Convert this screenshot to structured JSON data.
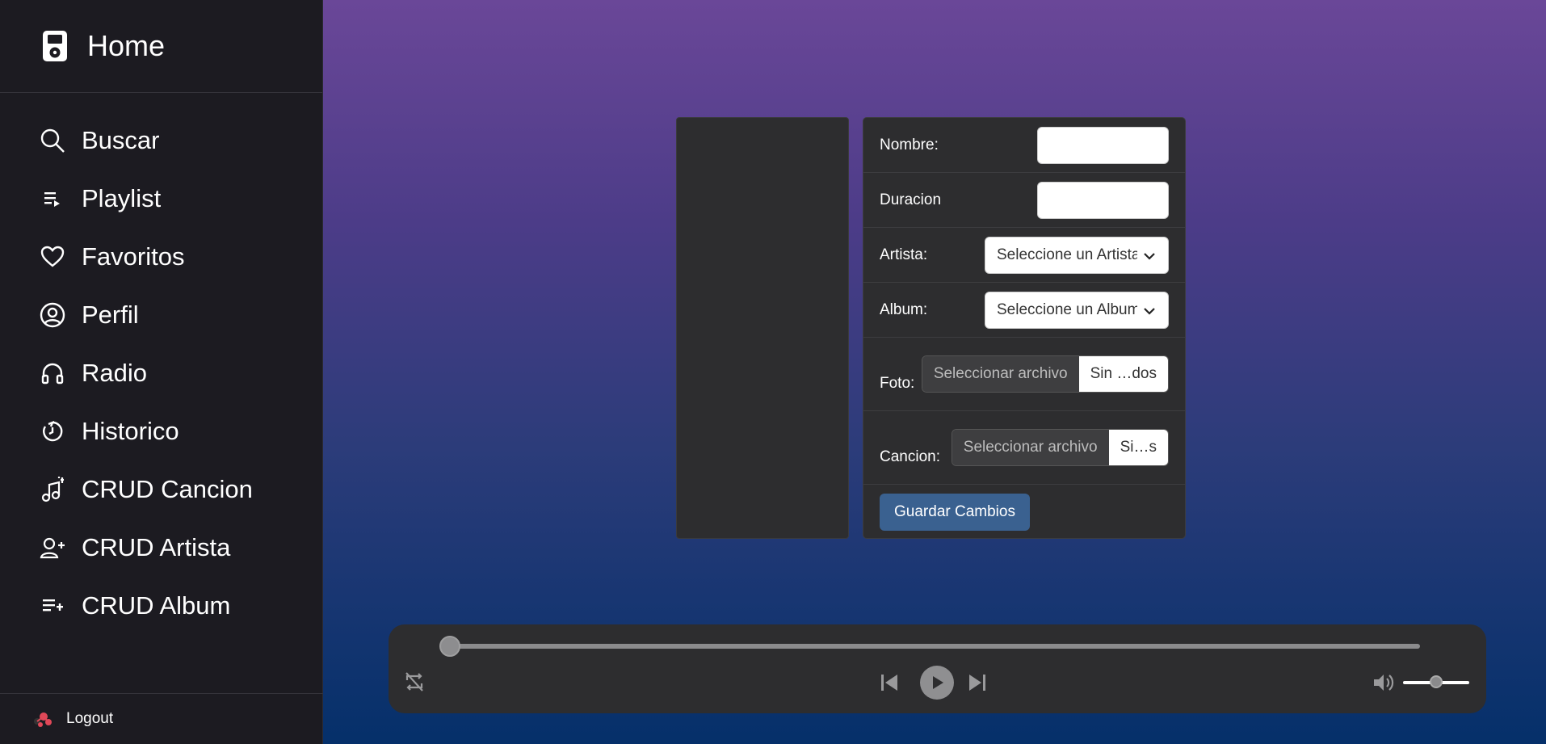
{
  "sidebar": {
    "home_label": "Home",
    "items": [
      {
        "label": "Buscar",
        "icon": "search-icon"
      },
      {
        "label": "Playlist",
        "icon": "playlist-icon"
      },
      {
        "label": "Favoritos",
        "icon": "heart-icon"
      },
      {
        "label": "Perfil",
        "icon": "user-circle-icon"
      },
      {
        "label": "Radio",
        "icon": "headphones-icon"
      },
      {
        "label": "Historico",
        "icon": "history-icon"
      },
      {
        "label": "CRUD Cancion",
        "icon": "music-add-icon"
      },
      {
        "label": "CRUD Artista",
        "icon": "user-add-icon"
      },
      {
        "label": "CRUD Album",
        "icon": "playlist-add-icon"
      }
    ],
    "logout_label": "Logout"
  },
  "form": {
    "nombre_label": "Nombre:",
    "nombre_value": "",
    "duracion_label": "Duracion",
    "duracion_value": "",
    "artista_label": "Artista:",
    "artista_selected": "Seleccione un Artista",
    "album_label": "Album:",
    "album_selected": "Seleccione un Album",
    "foto_label": "Foto:",
    "foto_button": "Seleccionar archivo",
    "foto_filename": "Sin …dos",
    "cancion_label": "Cancion:",
    "cancion_button": "Seleccionar archivo",
    "cancion_filename": "Si…s",
    "save_label": "Guardar Cambios"
  },
  "player": {
    "progress": 0.0,
    "volume": 0.5
  },
  "colors": {
    "sidebar_bg": "#1c1b21",
    "panel_bg": "#2d2d2f",
    "save_button": "#3a6190",
    "gradient_top": "#6a4798",
    "gradient_bottom": "#05306a"
  }
}
